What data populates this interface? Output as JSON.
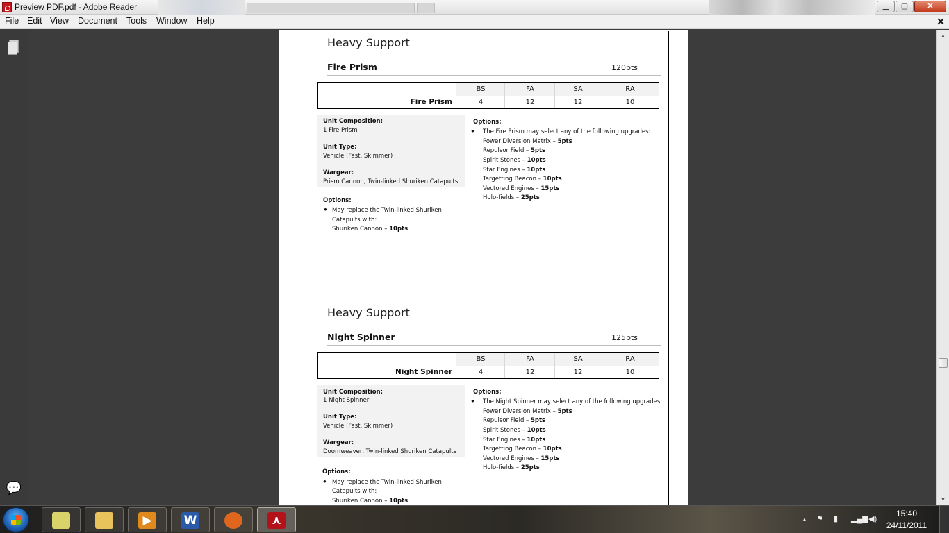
{
  "window": {
    "title": "Preview PDF.pdf - Adobe Reader",
    "minimize": "▁",
    "maximize": "▢",
    "close": "✕"
  },
  "menu": [
    "File",
    "Edit",
    "View",
    "Document",
    "Tools",
    "Window",
    "Help"
  ],
  "doc_close": "✕",
  "sections": [
    {
      "heading": "Heavy Support",
      "unit": "Fire Prism",
      "points": "120pts",
      "stat_headers": [
        "BS",
        "FA",
        "SA",
        "RA"
      ],
      "stat_name": "Fire Prism",
      "stats": [
        "4",
        "12",
        "12",
        "10"
      ],
      "composition_label": "Unit Composition:",
      "composition": "1 Fire Prism",
      "type_label": "Unit Type:",
      "type": "Vehicle (Fast, Skimmer)",
      "wargear_label": "Wargear:",
      "wargear": "Prism Cannon, Twin-linked Shuriken Catapults",
      "left_options_label": "Options:",
      "left_options": [
        "May replace the Twin-linked Shuriken",
        "Catapults with:",
        "Shuriken Cannon – ",
        "10pts"
      ],
      "right_options_label": "Options:",
      "right_intro": "The Fire Prism may select any of the following upgrades:",
      "upgrades": [
        {
          "name": "Power Diversion Matrix – ",
          "cost": "5pts"
        },
        {
          "name": "Repulsor Field – ",
          "cost": "5pts"
        },
        {
          "name": "Spirit Stones – ",
          "cost": "10pts"
        },
        {
          "name": "Star Engines – ",
          "cost": "10pts"
        },
        {
          "name": "Targetting Beacon – ",
          "cost": "10pts"
        },
        {
          "name": "Vectored Engines – ",
          "cost": "15pts"
        },
        {
          "name": "Holo-fields – ",
          "cost": "25pts"
        }
      ]
    },
    {
      "heading": "Heavy Support",
      "unit": "Night Spinner",
      "points": "125pts",
      "stat_headers": [
        "BS",
        "FA",
        "SA",
        "RA"
      ],
      "stat_name": "Night Spinner",
      "stats": [
        "4",
        "12",
        "12",
        "10"
      ],
      "composition_label": "Unit Composition:",
      "composition": "1 Night Spinner",
      "type_label": "Unit Type:",
      "type": "Vehicle (Fast, Skimmer)",
      "wargear_label": "Wargear:",
      "wargear": "Doomweaver, Twin-linked Shuriken Catapults",
      "left_options_label": "Options:",
      "left_options": [
        "May replace the Twin-linked Shuriken",
        "Catapults with:",
        "Shuriken Cannon – ",
        "10pts"
      ],
      "right_options_label": "Options:",
      "right_intro": "The Night Spinner may select any of the following upgrades:",
      "upgrades": [
        {
          "name": "Power Diversion Matrix – ",
          "cost": "5pts"
        },
        {
          "name": "Repulsor Field – ",
          "cost": "5pts"
        },
        {
          "name": "Spirit Stones – ",
          "cost": "10pts"
        },
        {
          "name": "Star Engines – ",
          "cost": "10pts"
        },
        {
          "name": "Targetting Beacon – ",
          "cost": "10pts"
        },
        {
          "name": "Vectored Engines – ",
          "cost": "15pts"
        },
        {
          "name": "Holo-fields – ",
          "cost": "25pts"
        }
      ]
    }
  ],
  "taskbar": {
    "apps": [
      {
        "name": "sticky-notes",
        "glyph": "",
        "color": "#d9d36a"
      },
      {
        "name": "windows-explorer",
        "glyph": "",
        "color": "#e8c25a"
      },
      {
        "name": "media-player",
        "glyph": "▶",
        "color": "#e08a1e"
      },
      {
        "name": "microsoft-word",
        "glyph": "W",
        "color": "#2b5ba8"
      },
      {
        "name": "firefox",
        "glyph": "",
        "color": "#e0661d"
      },
      {
        "name": "adobe-reader",
        "glyph": "⋏",
        "color": "#b3121b"
      }
    ],
    "tray_expand": "▲",
    "time": "15:40",
    "date": "24/11/2011"
  }
}
